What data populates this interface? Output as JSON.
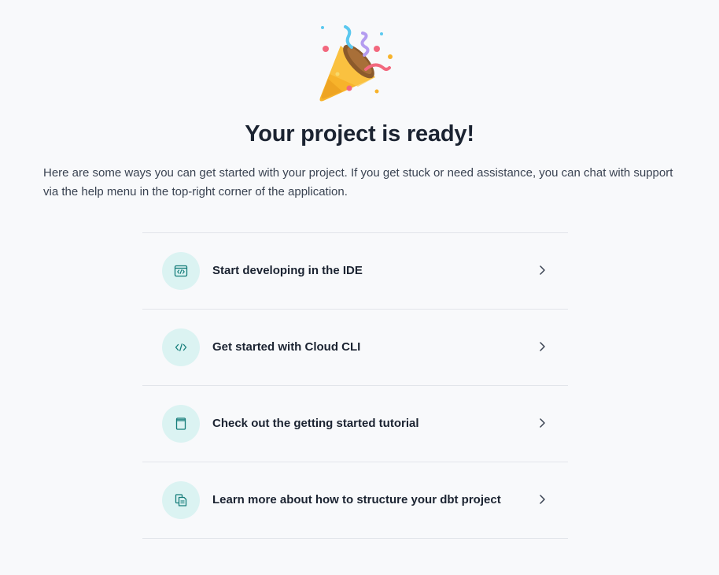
{
  "hero": {
    "icon": "party-popper-icon"
  },
  "title": "Your project is ready!",
  "intro": "Here are some ways you can get started with your project. If you get stuck or need assistance, you can chat with support via the help menu in the top-right corner of the application.",
  "options": [
    {
      "label": "Start developing in the IDE",
      "icon": "code-window-icon"
    },
    {
      "label": "Get started with Cloud CLI",
      "icon": "code-brackets-icon"
    },
    {
      "label": "Check out the getting started tutorial",
      "icon": "book-icon"
    },
    {
      "label": "Learn more about how to structure your dbt project",
      "icon": "documents-icon"
    }
  ],
  "colors": {
    "background": "#f8f9fb",
    "icon_circle": "#dbf3f2",
    "icon_stroke": "#157d7a",
    "divider": "#e2e5ea",
    "text_primary": "#1b2331"
  }
}
